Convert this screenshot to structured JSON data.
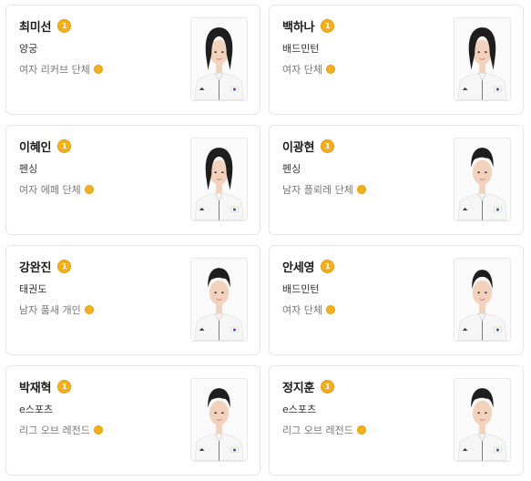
{
  "athletes": [
    {
      "name": "최미선",
      "medal": "1",
      "sport": "양궁",
      "event": "여자 리커브 단체",
      "hair": "long"
    },
    {
      "name": "백하나",
      "medal": "1",
      "sport": "배드민턴",
      "event": "여자 단체",
      "hair": "long"
    },
    {
      "name": "이혜인",
      "medal": "1",
      "sport": "펜싱",
      "event": "여자 에페 단체",
      "hair": "long"
    },
    {
      "name": "이광현",
      "medal": "1",
      "sport": "펜싱",
      "event": "남자 플뢰레 단체",
      "hair": "short"
    },
    {
      "name": "강완진",
      "medal": "1",
      "sport": "태권도",
      "event": "남자 품새 개인",
      "hair": "short"
    },
    {
      "name": "안세영",
      "medal": "1",
      "sport": "배드민턴",
      "event": "여자 단체",
      "hair": "tied"
    },
    {
      "name": "박재혁",
      "medal": "1",
      "sport": "e스포츠",
      "event": "리그 오브 레전드",
      "hair": "short"
    },
    {
      "name": "정지훈",
      "medal": "1",
      "sport": "e스포츠",
      "event": "리그 오브 레전드",
      "hair": "short"
    }
  ],
  "colors": {
    "gold": "#f2b01e",
    "hair": "#1e1e1e",
    "skin": "#f3d2bd",
    "jacket": "#f6f6f6"
  }
}
